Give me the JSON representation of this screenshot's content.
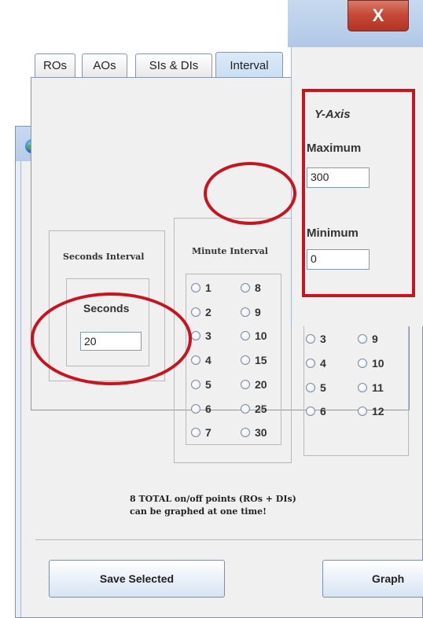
{
  "tabs": [
    {
      "label": "ROs"
    },
    {
      "label": "AOs"
    },
    {
      "label": "SIs & DIs"
    },
    {
      "label": "Interval"
    }
  ],
  "seconds_group": {
    "title": "Seconds Interval",
    "sub_label": "Seconds",
    "value": "20"
  },
  "minute_group": {
    "title": "Minute Interval",
    "options": [
      "1",
      "2",
      "3",
      "4",
      "5",
      "6",
      "7",
      "8",
      "9",
      "10",
      "15",
      "20",
      "25",
      "30"
    ]
  },
  "hour_group": {
    "options": [
      "3",
      "4",
      "5",
      "6",
      "9",
      "10",
      "11",
      "12"
    ]
  },
  "note": {
    "line1": "8 TOTAL on/off points (ROs + DIs)",
    "line2": "can be graphed at one time!"
  },
  "buttons": {
    "save": "Save Selected",
    "graph": "Graph"
  },
  "yaxis": {
    "title": "Y-Axis",
    "max_label": "Maximum",
    "max_value": "300",
    "min_label": "Minimum",
    "min_value": "0"
  },
  "close_glyph": "X"
}
